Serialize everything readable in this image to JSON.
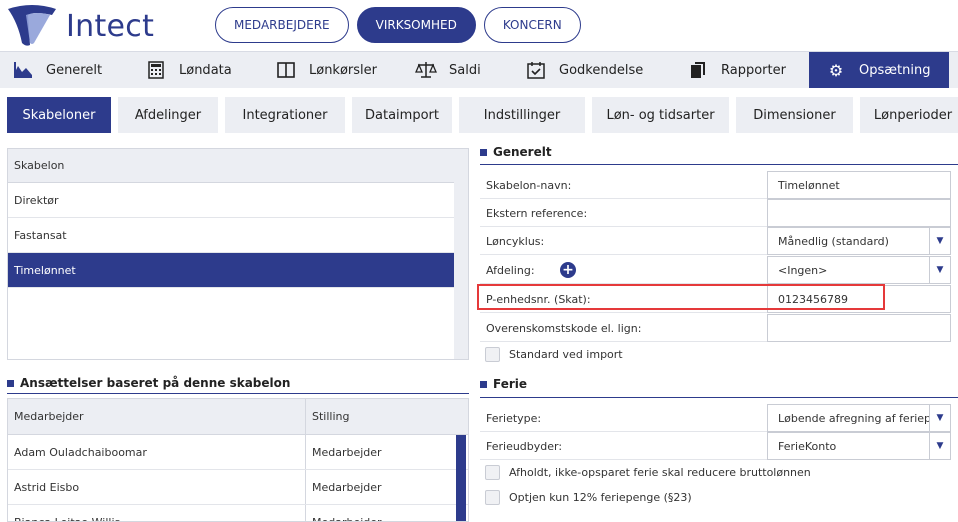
{
  "app": {
    "name": "Intect"
  },
  "top_tabs": [
    {
      "label": "MEDARBEJDERE",
      "active": false
    },
    {
      "label": "VIRKSOMHED",
      "active": true
    },
    {
      "label": "KONCERN",
      "active": false
    }
  ],
  "main_nav": [
    {
      "label": "Generelt",
      "icon": "chart-icon"
    },
    {
      "label": "Løndata",
      "icon": "calculator-icon"
    },
    {
      "label": "Lønkørsler",
      "icon": "book-icon"
    },
    {
      "label": "Saldi",
      "icon": "scale-icon"
    },
    {
      "label": "Godkendelse",
      "icon": "calendar-check-icon"
    },
    {
      "label": "Rapporter",
      "icon": "documents-icon"
    },
    {
      "label": "Opsætning",
      "icon": "gear-icon",
      "active": true
    }
  ],
  "sub_tabs": [
    {
      "label": "Skabeloner",
      "active": true
    },
    {
      "label": "Afdelinger"
    },
    {
      "label": "Integrationer"
    },
    {
      "label": "Dataimport"
    },
    {
      "label": "Indstillinger"
    },
    {
      "label": "Løn- og tidsarter"
    },
    {
      "label": "Dimensioner"
    },
    {
      "label": "Lønperioder"
    }
  ],
  "templates": {
    "header": "Skabelon",
    "rows": [
      "Direktør",
      "Fastansat",
      "Timelønnet"
    ],
    "selected": "Timelønnet"
  },
  "employments": {
    "title": "Ansættelser baseret på denne skabelon",
    "columns": [
      "Medarbejder",
      "Stilling"
    ],
    "rows": [
      {
        "name": "Adam Ouladchaiboomar",
        "position": "Medarbejder"
      },
      {
        "name": "Astrid Eisbo",
        "position": "Medarbejder"
      },
      {
        "name": "Bianca Leitao Willis",
        "position": "Medarbejder"
      }
    ]
  },
  "general": {
    "title": "Generelt",
    "template_name_label": "Skabelon-navn:",
    "template_name_value": "Timelønnet",
    "external_ref_label": "Ekstern reference:",
    "external_ref_value": "",
    "pay_cycle_label": "Løncyklus:",
    "pay_cycle_value": "Månedlig (standard)",
    "department_label": "Afdeling:",
    "department_value": "<Ingen>",
    "p_unit_label": "P-enhedsnr. (Skat):",
    "p_unit_value": "0123456789",
    "agreement_label": "Overenskomstskode el. lign:",
    "agreement_value": "",
    "default_import_label": "Standard ved import"
  },
  "vacation": {
    "title": "Ferie",
    "type_label": "Ferietype:",
    "type_value": "Løbende afregning af feriepe...",
    "provider_label": "Ferieudbyder:",
    "provider_value": "FerieKonto",
    "check1_label": "Afholdt, ikke-opsparet ferie skal reducere bruttolønnen",
    "check2_label": "Optjen kun 12% feriepenge (§23)"
  },
  "colors": {
    "brand": "#2d3b8c",
    "highlight": "#e5393a"
  }
}
